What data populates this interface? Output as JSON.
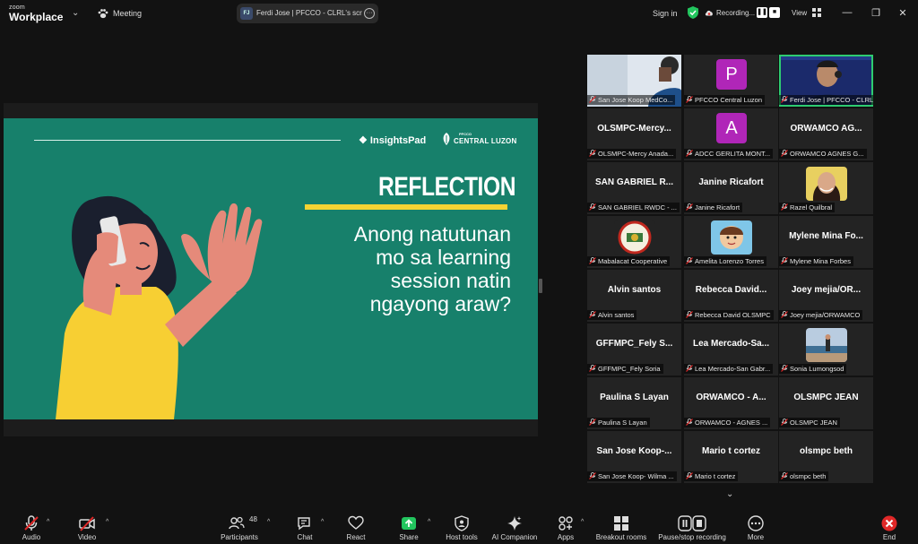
{
  "topbar": {
    "brand_small": "zoom",
    "brand_big": "Workplace",
    "meeting_label": "Meeting",
    "share_initials": "FJ",
    "share_text": "Ferdi Jose | PFCCO - CLRL's scree",
    "signin": "Sign in",
    "recording_label": "Recording...",
    "view_label": "View",
    "minimize": "—",
    "restore": "❐",
    "close": "✕"
  },
  "slide": {
    "logo1": "InsightsPad",
    "logo2_small": "PFCCO",
    "logo2_big": "CENTRAL LUZON",
    "title": "REFLECTION",
    "question_lines": [
      "Anong natutunan",
      "mo sa learning",
      "session natin",
      "ngayong araw?"
    ]
  },
  "gallery": {
    "tiles": [
      {
        "caption": "San Jose Koop MedCo...",
        "kind": "video"
      },
      {
        "caption": "PFCCO Central Luzon",
        "kind": "letter",
        "letter": "P"
      },
      {
        "caption": "Ferdi Jose | PFCCO - CLRL",
        "kind": "video2",
        "active": true
      },
      {
        "caption": "OLSMPC-Mercy Anada...",
        "big": "OLSMPC-Mercy...",
        "kind": "name"
      },
      {
        "caption": "ADCC GERLITA MONT...",
        "kind": "letter",
        "letter": "A"
      },
      {
        "caption": "ORWAMCO AGNES G...",
        "big": "ORWAMCO AG...",
        "kind": "name"
      },
      {
        "caption": "SAN GABRIEL RWDC - ...",
        "big": "SAN GABRIEL R...",
        "kind": "name"
      },
      {
        "caption": "Janine Ricafort",
        "big": "Janine Ricafort",
        "kind": "name"
      },
      {
        "caption": "Razel Quilbral",
        "kind": "photo"
      },
      {
        "caption": "Mabalacat Cooperative",
        "kind": "seal"
      },
      {
        "caption": "Amelita Lorenzo Torres",
        "kind": "cartoon"
      },
      {
        "caption": "Mylene Mina Forbes",
        "big": "Mylene Mina Fo...",
        "kind": "name"
      },
      {
        "caption": "Alvin santos",
        "big": "Alvin santos",
        "kind": "name"
      },
      {
        "caption": "Rebecca David OLSMPC",
        "big": "Rebecca David...",
        "kind": "name"
      },
      {
        "caption": "Joey mejia/ORWAMCO",
        "big": "Joey mejia/OR...",
        "kind": "name"
      },
      {
        "caption": "GFFMPC_Fely Soria",
        "big": "GFFMPC_Fely S...",
        "kind": "name"
      },
      {
        "caption": "Lea Mercado-San Gabr...",
        "big": "Lea Mercado-Sa...",
        "kind": "name"
      },
      {
        "caption": "Sonia Lumongsod",
        "kind": "beach"
      },
      {
        "caption": "Paulina S Layan",
        "big": "Paulina S Layan",
        "kind": "name"
      },
      {
        "caption": "ORWAMCO - AGNES ...",
        "big": "ORWAMCO - A...",
        "kind": "name"
      },
      {
        "caption": "OLSMPC JEAN",
        "big": "OLSMPC JEAN",
        "kind": "name"
      },
      {
        "caption": "San Jose Koop- Wilma ...",
        "big": "San Jose Koop-...",
        "kind": "name"
      },
      {
        "caption": "Mario t cortez",
        "big": "Mario t cortez",
        "kind": "name"
      },
      {
        "caption": "olsmpc beth",
        "big": "olsmpc beth",
        "kind": "name"
      }
    ]
  },
  "toolbar": {
    "audio": "Audio",
    "video": "Video",
    "participants": "Participants",
    "participants_count": "48",
    "chat": "Chat",
    "react": "React",
    "share": "Share",
    "host_tools": "Host tools",
    "ai_companion": "AI Companion",
    "apps": "Apps",
    "breakout_rooms": "Breakout rooms",
    "pause_recording": "Pause/stop recording",
    "more": "More",
    "end": "End"
  },
  "colors": {
    "slide_bg": "#17806b",
    "accent_yellow": "#f5d333",
    "active_border": "#2ecc71",
    "avatar_purple": "#b026b8",
    "end_red": "#e02828"
  }
}
